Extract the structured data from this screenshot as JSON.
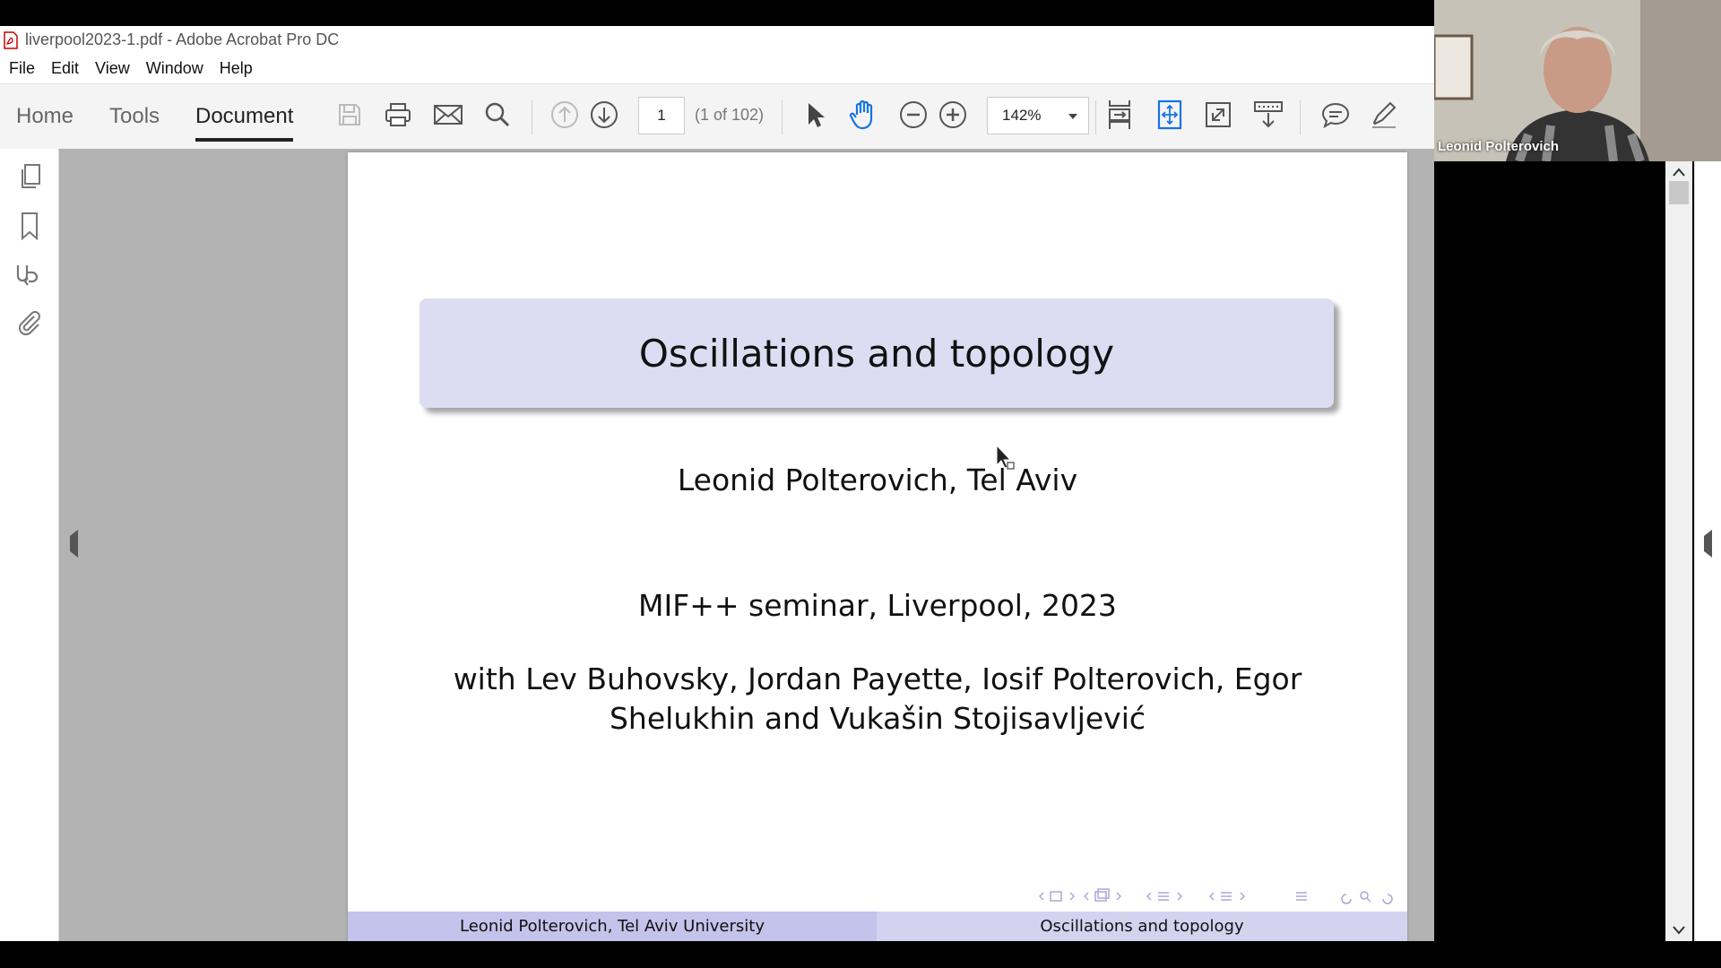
{
  "window": {
    "title": "liverpool2023-1.pdf - Adobe Acrobat Pro DC"
  },
  "menu": {
    "items": [
      "File",
      "Edit",
      "View",
      "Window",
      "Help"
    ]
  },
  "nav_tabs": {
    "home": "Home",
    "tools": "Tools",
    "document": "Document",
    "active": "Document"
  },
  "toolbar": {
    "page_number": "1",
    "page_count": "(1 of 102)",
    "zoom": "142%",
    "icons": [
      "save-icon",
      "print-icon",
      "email-icon",
      "search-icon",
      "prev-page-icon",
      "next-page-icon",
      "select-cursor-icon",
      "hand-tool-icon",
      "zoom-out-icon",
      "zoom-in-icon",
      "scroll-mode-icon",
      "fit-page-icon",
      "fullscreen-icon",
      "read-mode-icon",
      "comment-icon",
      "highlight-pen-icon"
    ]
  },
  "left_rail": {
    "icons": [
      "pages-icon",
      "bookmark-icon",
      "signature-icon",
      "attachment-icon"
    ]
  },
  "slide": {
    "title": "Oscillations and topology",
    "author": "Leonid Polterovich, Tel Aviv",
    "event": "MIF++ seminar, Liverpool, 2023",
    "coauthors_line1": "with Lev Buhovsky, Jordan Payette, Iosif Polterovich, Egor",
    "coauthors_line2": "Shelukhin and Vukašin Stojisavljević",
    "footer_left": "Leonid Polterovich, Tel Aviv University",
    "footer_right": "Oscillations and topology"
  },
  "video": {
    "participant_name": "Leonid Polterovich"
  },
  "colors": {
    "title_box": "#dcdcf2",
    "footer_left": "#c3c3eb",
    "footer_right": "#d3d3f0",
    "accent_blue": "#1473e6"
  }
}
